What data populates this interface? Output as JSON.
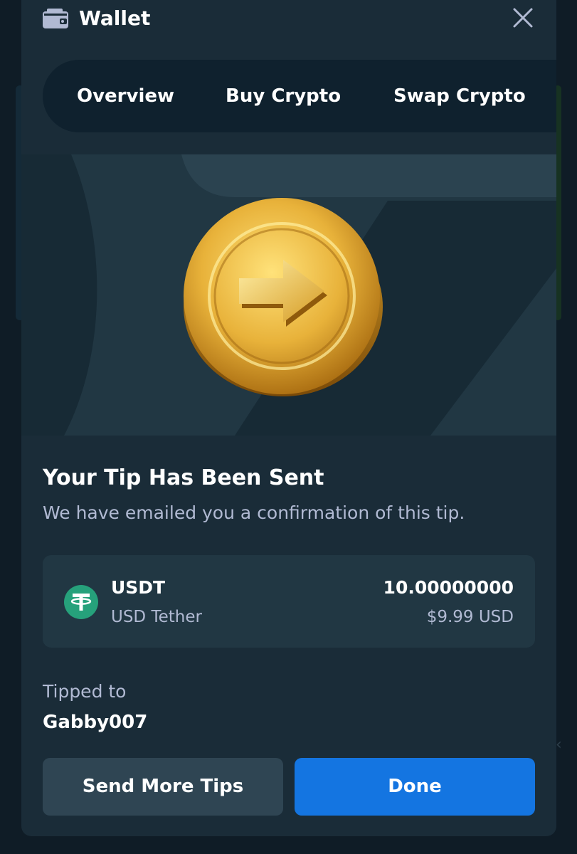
{
  "header": {
    "title": "Wallet",
    "icon": "wallet-icon",
    "close_icon": "close-icon"
  },
  "tabs": [
    {
      "label": "Overview"
    },
    {
      "label": "Buy Crypto"
    },
    {
      "label": "Swap Crypto"
    }
  ],
  "hero": {
    "icon": "coin-arrow-icon"
  },
  "confirmation": {
    "title": "Your Tip Has Been Sent",
    "subtitle": "We have emailed you a confirmation of this tip."
  },
  "currency": {
    "symbol": "USDT",
    "name": "USD Tether",
    "amount": "10.00000000",
    "usd_value": "$9.99 USD",
    "icon": "tether-icon"
  },
  "recipient": {
    "label": "Tipped to",
    "name": "Gabby007"
  },
  "buttons": {
    "secondary": "Send More Tips",
    "primary": "Done"
  },
  "colors": {
    "background": "#0f1c26",
    "modal": "#1a2c38",
    "card": "#213743",
    "primary_button": "#1475e1",
    "secondary_button": "#2f4553",
    "tether": "#26a17b",
    "coin_gold": "#e8b23a"
  }
}
